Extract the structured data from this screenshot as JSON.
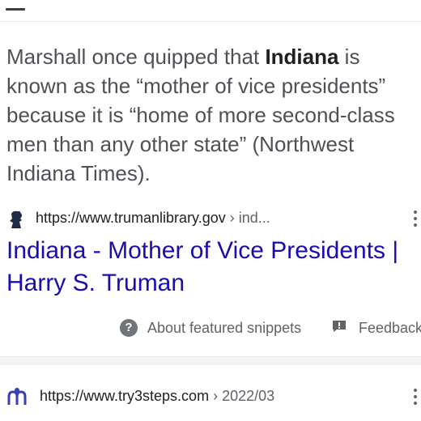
{
  "snippet": {
    "lines": [
      {
        "pre": "Marshall once quipped that ",
        "bold": "Indiana",
        "post": " is"
      },
      {
        "text": "known as the “mother of vice presidents”"
      },
      {
        "text": "because it is “home of more second-class"
      },
      {
        "text": "men than any other state” (Northwest"
      },
      {
        "text": "Indiana Times)."
      }
    ]
  },
  "result1": {
    "favicon": "truman-silhouette-icon",
    "url": "https://www.trumanlibrary.gov",
    "breadcrumb": " › ind...",
    "title_line1": "Indiana - Mother of Vice Presidents |",
    "title_line2": "Harry S. Truman"
  },
  "featured": {
    "help_icon": "?",
    "about_label": "About featured snippets",
    "feedback_icon": "feedback-flag-icon",
    "feedback_label": "Feedback"
  },
  "result2": {
    "favicon": "try3steps-logo-icon",
    "url": "https://www.try3steps.com",
    "breadcrumb": " › 2022/03"
  },
  "colors": {
    "link": "#1a0dab",
    "text": "#4d5156",
    "muted": "#5f6368",
    "favicon2": "#3b3fb6"
  }
}
